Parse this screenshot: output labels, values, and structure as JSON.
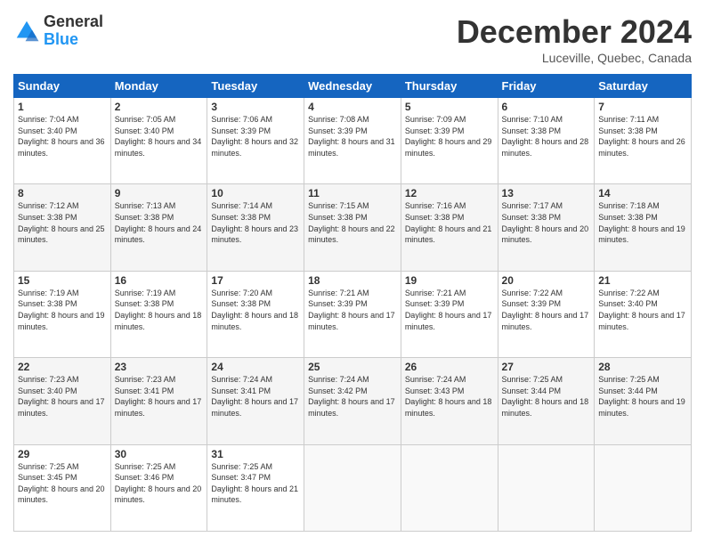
{
  "logo": {
    "general": "General",
    "blue": "Blue"
  },
  "title": "December 2024",
  "subtitle": "Luceville, Quebec, Canada",
  "headers": [
    "Sunday",
    "Monday",
    "Tuesday",
    "Wednesday",
    "Thursday",
    "Friday",
    "Saturday"
  ],
  "weeks": [
    [
      {
        "day": "1",
        "sunrise": "Sunrise: 7:04 AM",
        "sunset": "Sunset: 3:40 PM",
        "daylight": "Daylight: 8 hours and 36 minutes."
      },
      {
        "day": "2",
        "sunrise": "Sunrise: 7:05 AM",
        "sunset": "Sunset: 3:40 PM",
        "daylight": "Daylight: 8 hours and 34 minutes."
      },
      {
        "day": "3",
        "sunrise": "Sunrise: 7:06 AM",
        "sunset": "Sunset: 3:39 PM",
        "daylight": "Daylight: 8 hours and 32 minutes."
      },
      {
        "day": "4",
        "sunrise": "Sunrise: 7:08 AM",
        "sunset": "Sunset: 3:39 PM",
        "daylight": "Daylight: 8 hours and 31 minutes."
      },
      {
        "day": "5",
        "sunrise": "Sunrise: 7:09 AM",
        "sunset": "Sunset: 3:39 PM",
        "daylight": "Daylight: 8 hours and 29 minutes."
      },
      {
        "day": "6",
        "sunrise": "Sunrise: 7:10 AM",
        "sunset": "Sunset: 3:38 PM",
        "daylight": "Daylight: 8 hours and 28 minutes."
      },
      {
        "day": "7",
        "sunrise": "Sunrise: 7:11 AM",
        "sunset": "Sunset: 3:38 PM",
        "daylight": "Daylight: 8 hours and 26 minutes."
      }
    ],
    [
      {
        "day": "8",
        "sunrise": "Sunrise: 7:12 AM",
        "sunset": "Sunset: 3:38 PM",
        "daylight": "Daylight: 8 hours and 25 minutes."
      },
      {
        "day": "9",
        "sunrise": "Sunrise: 7:13 AM",
        "sunset": "Sunset: 3:38 PM",
        "daylight": "Daylight: 8 hours and 24 minutes."
      },
      {
        "day": "10",
        "sunrise": "Sunrise: 7:14 AM",
        "sunset": "Sunset: 3:38 PM",
        "daylight": "Daylight: 8 hours and 23 minutes."
      },
      {
        "day": "11",
        "sunrise": "Sunrise: 7:15 AM",
        "sunset": "Sunset: 3:38 PM",
        "daylight": "Daylight: 8 hours and 22 minutes."
      },
      {
        "day": "12",
        "sunrise": "Sunrise: 7:16 AM",
        "sunset": "Sunset: 3:38 PM",
        "daylight": "Daylight: 8 hours and 21 minutes."
      },
      {
        "day": "13",
        "sunrise": "Sunrise: 7:17 AM",
        "sunset": "Sunset: 3:38 PM",
        "daylight": "Daylight: 8 hours and 20 minutes."
      },
      {
        "day": "14",
        "sunrise": "Sunrise: 7:18 AM",
        "sunset": "Sunset: 3:38 PM",
        "daylight": "Daylight: 8 hours and 19 minutes."
      }
    ],
    [
      {
        "day": "15",
        "sunrise": "Sunrise: 7:19 AM",
        "sunset": "Sunset: 3:38 PM",
        "daylight": "Daylight: 8 hours and 19 minutes."
      },
      {
        "day": "16",
        "sunrise": "Sunrise: 7:19 AM",
        "sunset": "Sunset: 3:38 PM",
        "daylight": "Daylight: 8 hours and 18 minutes."
      },
      {
        "day": "17",
        "sunrise": "Sunrise: 7:20 AM",
        "sunset": "Sunset: 3:38 PM",
        "daylight": "Daylight: 8 hours and 18 minutes."
      },
      {
        "day": "18",
        "sunrise": "Sunrise: 7:21 AM",
        "sunset": "Sunset: 3:39 PM",
        "daylight": "Daylight: 8 hours and 17 minutes."
      },
      {
        "day": "19",
        "sunrise": "Sunrise: 7:21 AM",
        "sunset": "Sunset: 3:39 PM",
        "daylight": "Daylight: 8 hours and 17 minutes."
      },
      {
        "day": "20",
        "sunrise": "Sunrise: 7:22 AM",
        "sunset": "Sunset: 3:39 PM",
        "daylight": "Daylight: 8 hours and 17 minutes."
      },
      {
        "day": "21",
        "sunrise": "Sunrise: 7:22 AM",
        "sunset": "Sunset: 3:40 PM",
        "daylight": "Daylight: 8 hours and 17 minutes."
      }
    ],
    [
      {
        "day": "22",
        "sunrise": "Sunrise: 7:23 AM",
        "sunset": "Sunset: 3:40 PM",
        "daylight": "Daylight: 8 hours and 17 minutes."
      },
      {
        "day": "23",
        "sunrise": "Sunrise: 7:23 AM",
        "sunset": "Sunset: 3:41 PM",
        "daylight": "Daylight: 8 hours and 17 minutes."
      },
      {
        "day": "24",
        "sunrise": "Sunrise: 7:24 AM",
        "sunset": "Sunset: 3:41 PM",
        "daylight": "Daylight: 8 hours and 17 minutes."
      },
      {
        "day": "25",
        "sunrise": "Sunrise: 7:24 AM",
        "sunset": "Sunset: 3:42 PM",
        "daylight": "Daylight: 8 hours and 17 minutes."
      },
      {
        "day": "26",
        "sunrise": "Sunrise: 7:24 AM",
        "sunset": "Sunset: 3:43 PM",
        "daylight": "Daylight: 8 hours and 18 minutes."
      },
      {
        "day": "27",
        "sunrise": "Sunrise: 7:25 AM",
        "sunset": "Sunset: 3:44 PM",
        "daylight": "Daylight: 8 hours and 18 minutes."
      },
      {
        "day": "28",
        "sunrise": "Sunrise: 7:25 AM",
        "sunset": "Sunset: 3:44 PM",
        "daylight": "Daylight: 8 hours and 19 minutes."
      }
    ],
    [
      {
        "day": "29",
        "sunrise": "Sunrise: 7:25 AM",
        "sunset": "Sunset: 3:45 PM",
        "daylight": "Daylight: 8 hours and 20 minutes."
      },
      {
        "day": "30",
        "sunrise": "Sunrise: 7:25 AM",
        "sunset": "Sunset: 3:46 PM",
        "daylight": "Daylight: 8 hours and 20 minutes."
      },
      {
        "day": "31",
        "sunrise": "Sunrise: 7:25 AM",
        "sunset": "Sunset: 3:47 PM",
        "daylight": "Daylight: 8 hours and 21 minutes."
      },
      null,
      null,
      null,
      null
    ]
  ]
}
